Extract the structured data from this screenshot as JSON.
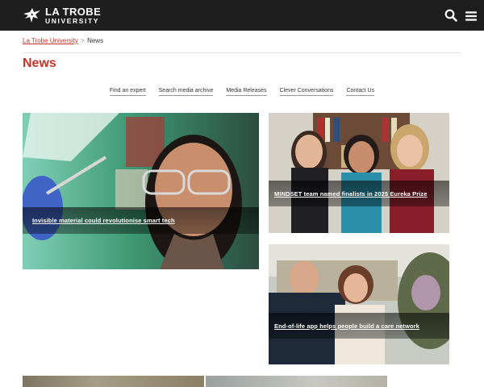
{
  "header": {
    "logo_line1": "LA TROBE",
    "logo_line2": "UNIVERSITY",
    "bg_color": "#1e1e1e",
    "search_icon": "search-icon",
    "menu_icon": "hamburger-menu-icon"
  },
  "breadcrumb": {
    "home": "La Trobe University",
    "separator": ">",
    "current": "News"
  },
  "page": {
    "title": "News",
    "accent_color": "#c4352a"
  },
  "subnav": {
    "items": [
      "Find an expert",
      "Search media archive",
      "Media Releases",
      "Clever Conversations",
      "Contact Us"
    ]
  },
  "stories": [
    {
      "headline": "Invisible material could revolutionise smart tech"
    },
    {
      "headline": "MINDSET team named finalists in 2025 Eureka Prize"
    },
    {
      "headline": "End-of-life app helps people build a care network"
    }
  ]
}
